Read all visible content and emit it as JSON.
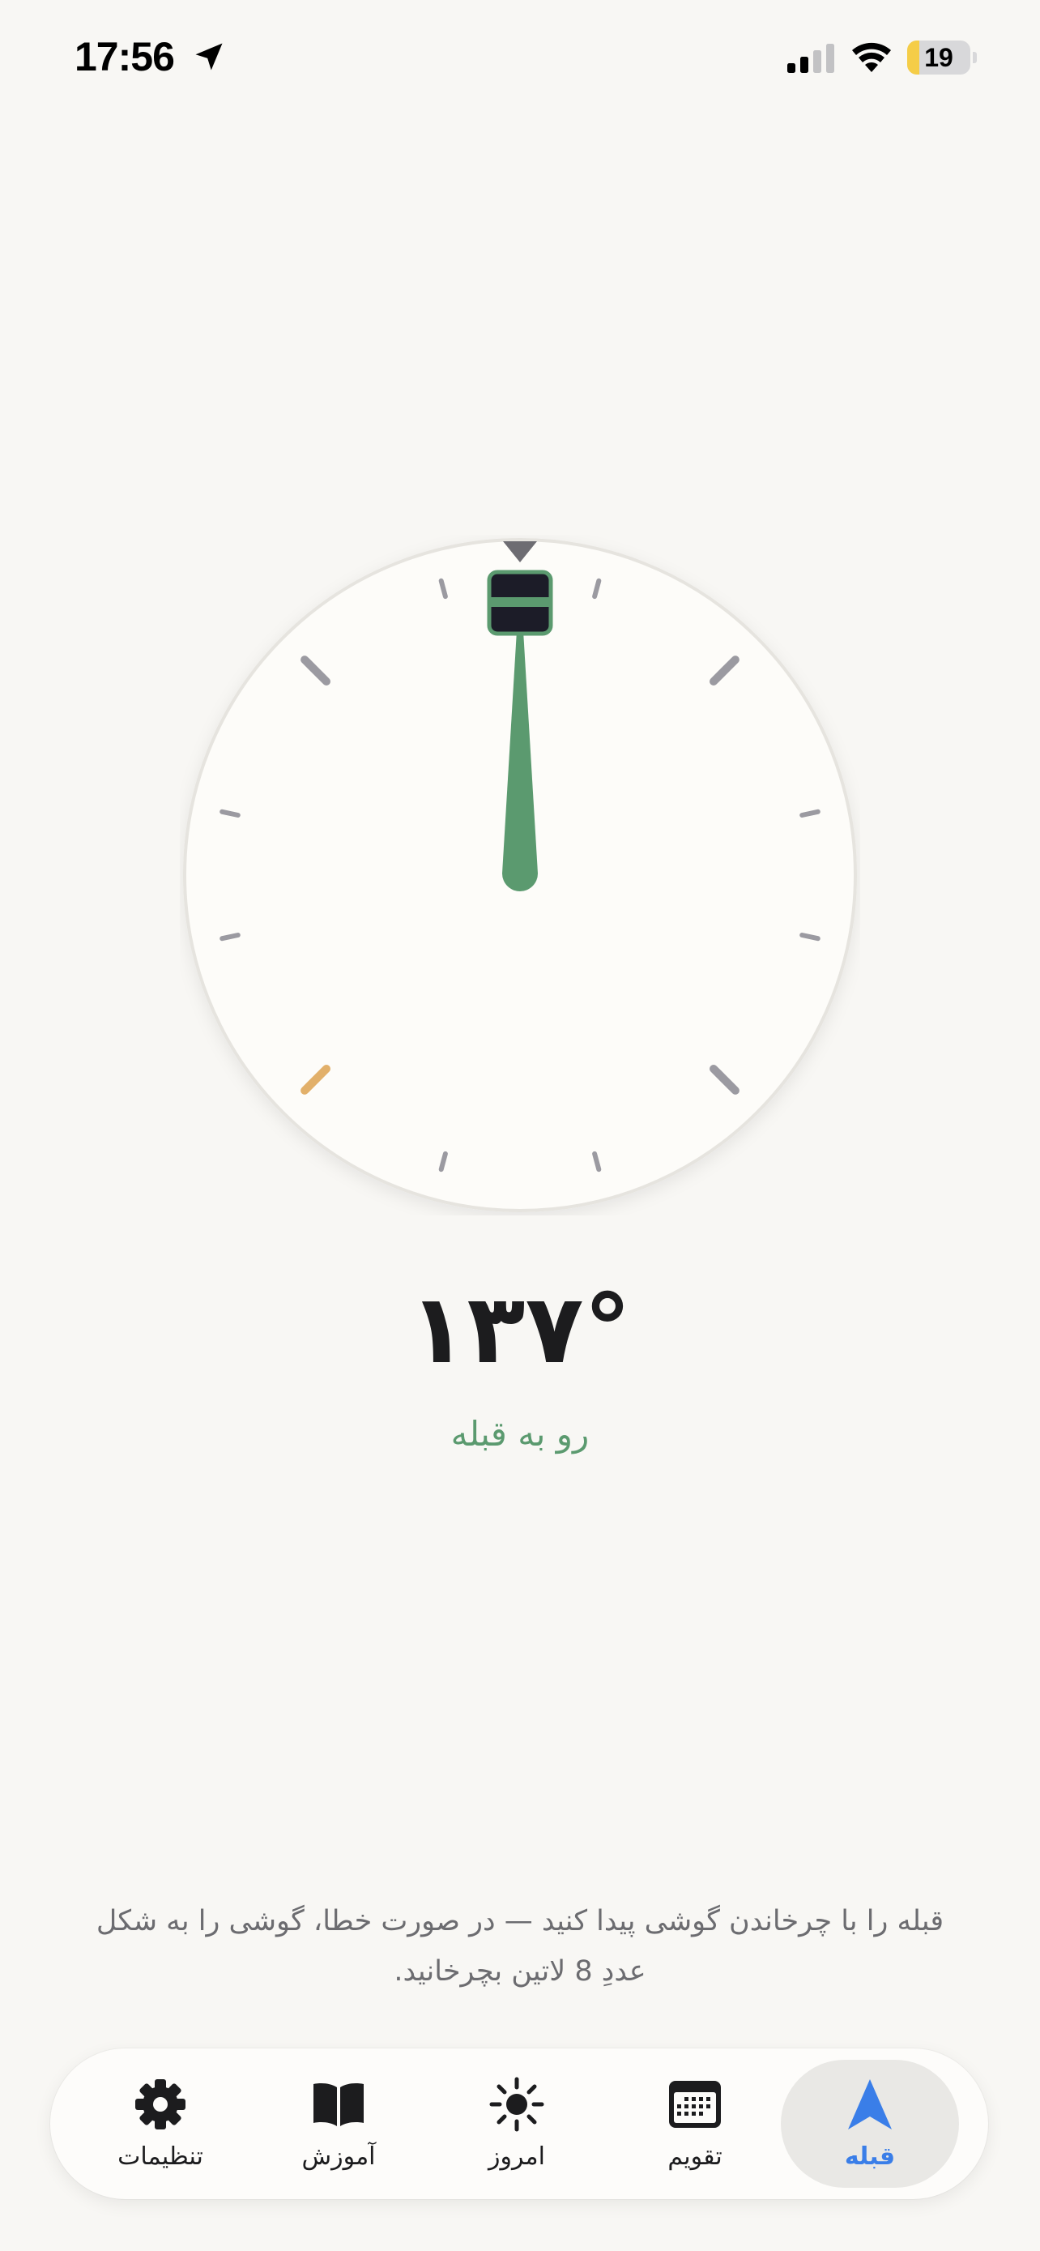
{
  "status_bar": {
    "time": "17:56",
    "battery_level": "19",
    "battery_fraction": 0.19,
    "signal_bars": 2,
    "location_icon": "location-arrow-icon",
    "wifi_icon": "wifi-icon"
  },
  "compass": {
    "heading_text": "١٣٧°",
    "status_text": "رو به قبله",
    "icons": {
      "top_marker": "triangle-down-icon",
      "kaaba": "kaaba-icon",
      "needle": "needle-icon"
    },
    "colors": {
      "needle": "#5b9a6f",
      "tick": "#9b9aa1",
      "highlight_tick": "#e2b06a",
      "dial": "#fdfcf9"
    }
  },
  "instruction": "قبله را با چرخاندن گوشی پیدا کنید — در صورت خطا، گوشی را به شکل عددِ 8 لاتین بچرخانید.",
  "tab_bar": {
    "tabs": [
      {
        "label": "تنظیمات",
        "icon": "gear-icon"
      },
      {
        "label": "آموزش",
        "icon": "book-icon"
      },
      {
        "label": "امروز",
        "icon": "sun-icon"
      },
      {
        "label": "تقویم",
        "icon": "calendar-icon"
      },
      {
        "label": "قبله",
        "icon": "navigation-arrow-icon",
        "active": true
      }
    ],
    "active_color": "#3a7ee8"
  }
}
